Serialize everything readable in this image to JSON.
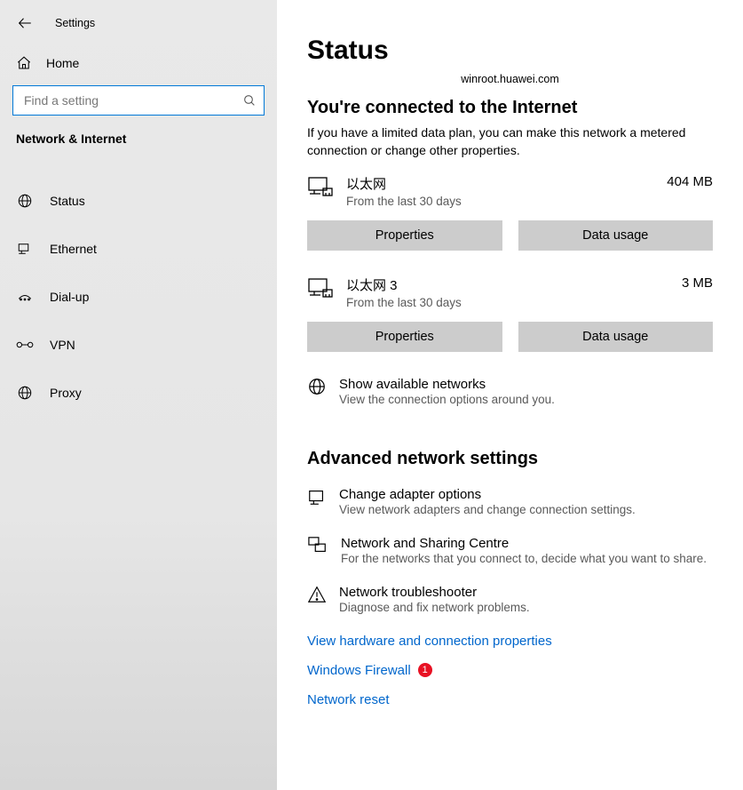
{
  "header": {
    "title": "Settings"
  },
  "sidebar": {
    "home": "Home",
    "search_placeholder": "Find a setting",
    "category": "Network & Internet",
    "items": [
      {
        "label": "Status",
        "icon": "globe-icon"
      },
      {
        "label": "Ethernet",
        "icon": "ethernet-icon"
      },
      {
        "label": "Dial-up",
        "icon": "dialup-icon"
      },
      {
        "label": "VPN",
        "icon": "vpn-icon"
      },
      {
        "label": "Proxy",
        "icon": "proxy-icon"
      }
    ]
  },
  "main": {
    "title": "Status",
    "domain": "winroot.huawei.com",
    "connected_title": "You're connected to the Internet",
    "connected_desc": "If you have a limited data plan, you can make this network a metered connection or change other properties.",
    "networks": [
      {
        "name": "以太网",
        "sub": "From the last 30 days",
        "usage": "404 MB",
        "btn_props": "Properties",
        "btn_usage": "Data usage"
      },
      {
        "name": "以太网 3",
        "sub": "From the last 30 days",
        "usage": "3 MB",
        "btn_props": "Properties",
        "btn_usage": "Data usage"
      }
    ],
    "show_networks": {
      "title": "Show available networks",
      "sub": "View the connection options around you."
    },
    "adv_heading": "Advanced network settings",
    "adv_items": [
      {
        "title": "Change adapter options",
        "sub": "View network adapters and change connection settings."
      },
      {
        "title": "Network and Sharing Centre",
        "sub": "For the networks that you connect to, decide what you want to share."
      },
      {
        "title": "Network troubleshooter",
        "sub": "Diagnose and fix network problems."
      }
    ],
    "links": {
      "hw": "View hardware and connection properties",
      "firewall": "Windows Firewall",
      "firewall_badge": "1",
      "reset": "Network reset"
    }
  }
}
